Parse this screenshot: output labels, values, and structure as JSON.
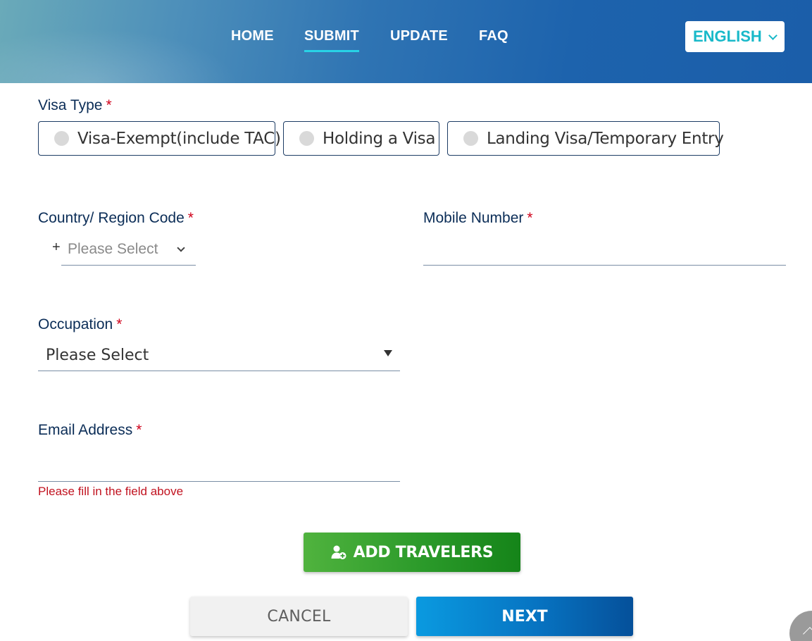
{
  "nav": {
    "items": [
      {
        "label": "HOME",
        "active": false
      },
      {
        "label": "SUBMIT",
        "active": true
      },
      {
        "label": "UPDATE",
        "active": false
      },
      {
        "label": "FAQ",
        "active": false
      }
    ],
    "language": {
      "label": "ENGLISH",
      "icon": "chevron-down-icon"
    }
  },
  "form": {
    "required_mark": "*",
    "visa_type": {
      "label": "Visa Type",
      "options": [
        {
          "label": "Visa-Exempt(include TAC)",
          "selected": false
        },
        {
          "label": "Holding a Visa",
          "selected": false
        },
        {
          "label": "Landing Visa/Temporary Entry",
          "selected": false
        }
      ]
    },
    "country_code": {
      "label": "Country/ Region Code",
      "prefix": "+",
      "placeholder": "Please Select",
      "icon": "chevron-down-icon"
    },
    "mobile": {
      "label": "Mobile Number",
      "value": ""
    },
    "occupation": {
      "label": "Occupation",
      "value": "Please Select",
      "icon": "caret-down-icon"
    },
    "email": {
      "label": "Email Address",
      "value": "",
      "error": "Please fill in the field above"
    }
  },
  "actions": {
    "add_travelers": {
      "label": "ADD TRAVELERS",
      "icon": "add-user-icon"
    },
    "cancel": "CANCEL",
    "next": "NEXT"
  },
  "scroll_top": {
    "icon": "chevron-up-icon"
  },
  "colors": {
    "header_start": "#6aaab9",
    "header_end": "#1b5ea9",
    "accent_cyan": "#19b9c9",
    "label_navy": "#0b2d57",
    "required_red": "#d0021b",
    "error_red": "#c1121f",
    "add_green": "#2b9a2a",
    "next_blue": "#0774c2"
  }
}
